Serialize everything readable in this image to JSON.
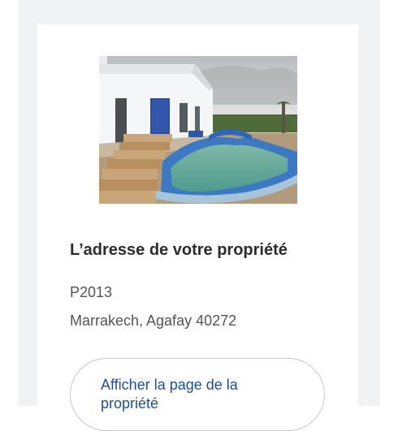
{
  "property": {
    "title": "L’adresse de votre propriété",
    "reference": "P2013",
    "address": "Marrakech, Agafay 40272"
  },
  "actions": {
    "view_property_label": "Afficher la page de la propriété"
  },
  "colors": {
    "page_background": "#f1f2f3",
    "card_background": "#ffffff",
    "title_text": "#2c2c2c",
    "body_text": "#545454",
    "link_text": "#1f4f96",
    "button_border": "#c8c8c8"
  }
}
